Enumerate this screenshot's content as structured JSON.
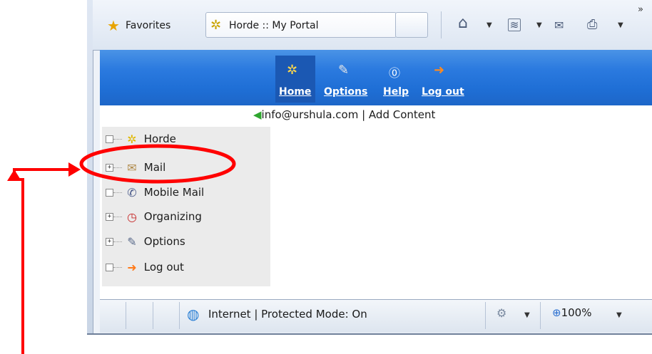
{
  "browser": {
    "favorites_label": "Favorites",
    "tab_title": "Horde :: My Portal",
    "toolbar_icons": [
      "home-icon",
      "feeds-icon",
      "mail-icon",
      "print-icon"
    ],
    "chevron": "»"
  },
  "portal": {
    "nav": [
      {
        "label": "Home",
        "icon": "gear-icon"
      },
      {
        "label": "Options",
        "icon": "wrench-icon"
      },
      {
        "label": "Help",
        "icon": "help-icon"
      },
      {
        "label": "Log out",
        "icon": "logout-arrow-icon"
      }
    ],
    "user_line": "info@urshula.com | Add Content",
    "tree": [
      {
        "label": "Horde",
        "expandable": false,
        "icon": "gear-icon"
      },
      {
        "label": "Mail",
        "expandable": true,
        "icon": "envelope-icon"
      },
      {
        "label": "Mobile Mail",
        "expandable": false,
        "icon": "mobile-icon"
      },
      {
        "label": "Organizing",
        "expandable": true,
        "icon": "clock-icon"
      },
      {
        "label": "Options",
        "expandable": true,
        "icon": "wrench-icon"
      },
      {
        "label": "Log out",
        "expandable": false,
        "icon": "logout-arrow-icon"
      }
    ]
  },
  "status": {
    "zone_text": "Internet | Protected Mode: On",
    "zoom": "100%"
  },
  "colors": {
    "nav_bar": "#1f6fd6",
    "annotation": "#ff0000"
  }
}
